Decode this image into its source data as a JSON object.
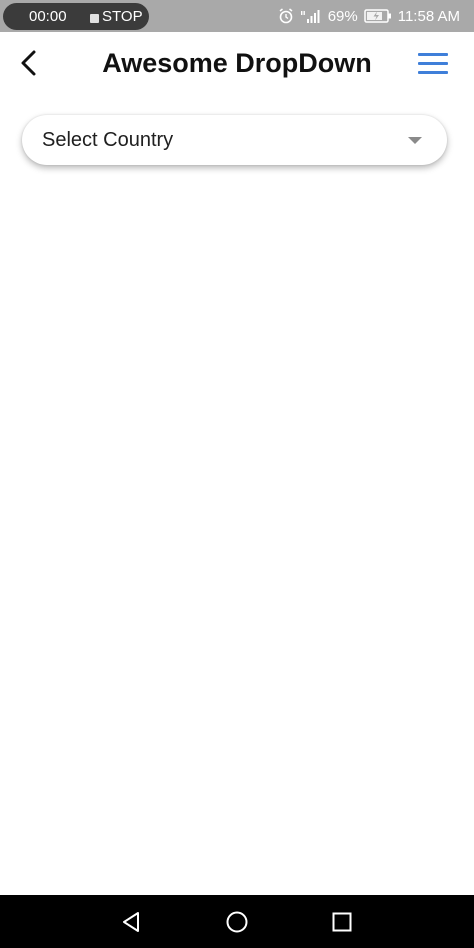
{
  "status_bar": {
    "recorder_time": "00:00",
    "recorder_stop": "STOP",
    "battery_percent": "69%",
    "clock": "11:58 AM",
    "icons": [
      "alarm-icon",
      "signal-icon",
      "battery-icon"
    ]
  },
  "app_bar": {
    "title": "Awesome DropDown",
    "back_icon": "chevron-left-icon",
    "menu_icon": "hamburger-menu-icon",
    "menu_color": "#3f7fd9"
  },
  "dropdown": {
    "placeholder": "Select Country",
    "caret_icon": "caret-down-icon"
  },
  "nav_bar": {
    "icons": [
      "back-triangle-icon",
      "home-circle-icon",
      "recents-square-icon"
    ]
  }
}
